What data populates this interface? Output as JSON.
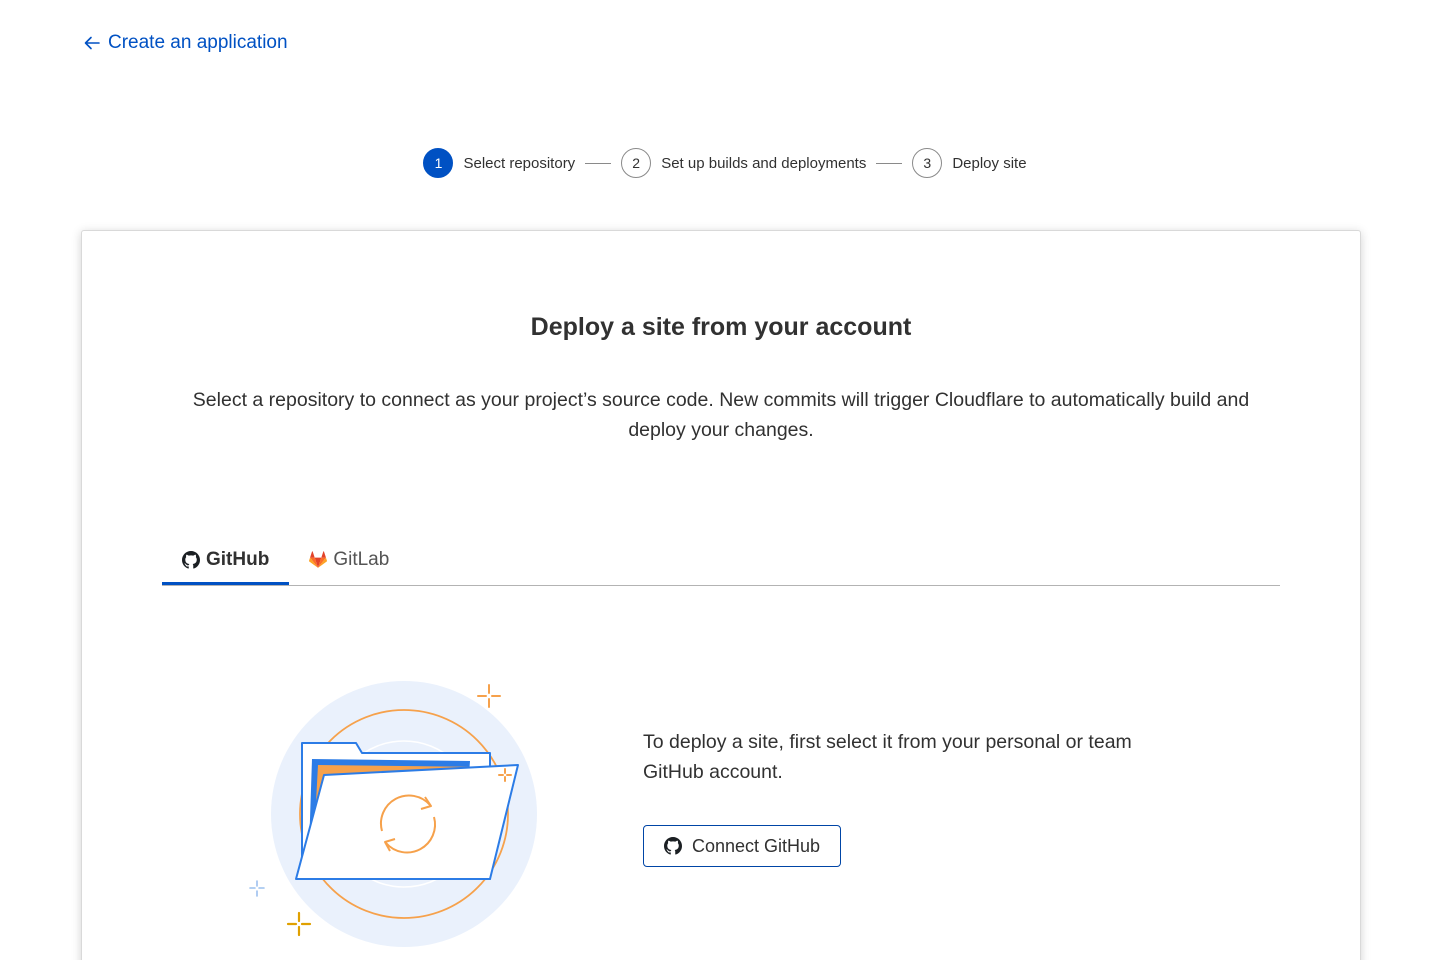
{
  "back_link": {
    "label": "Create an application"
  },
  "stepper": {
    "steps": [
      {
        "number": "1",
        "label": "Select repository",
        "active": true
      },
      {
        "number": "2",
        "label": "Set up builds and deployments",
        "active": false
      },
      {
        "number": "3",
        "label": "Deploy site",
        "active": false
      }
    ]
  },
  "card": {
    "title": "Deploy a site from your account",
    "description": "Select a repository to connect as your project’s source code. New commits will trigger Cloudflare to automatically build and deploy your changes.",
    "tabs": [
      {
        "label": "GitHub",
        "icon": "github-icon",
        "active": true
      },
      {
        "label": "GitLab",
        "icon": "gitlab-icon",
        "active": false
      }
    ],
    "connect_text": "To deploy a site, first select it from your personal or team GitHub account.",
    "connect_button": {
      "label": "Connect GitHub",
      "icon": "github-icon"
    }
  },
  "colors": {
    "accent": "#0051c3",
    "text": "#313131",
    "illustration_orange": "#f6a14b",
    "illustration_blue": "#2c7ce6",
    "illustration_bg": "#eaf1fc"
  }
}
